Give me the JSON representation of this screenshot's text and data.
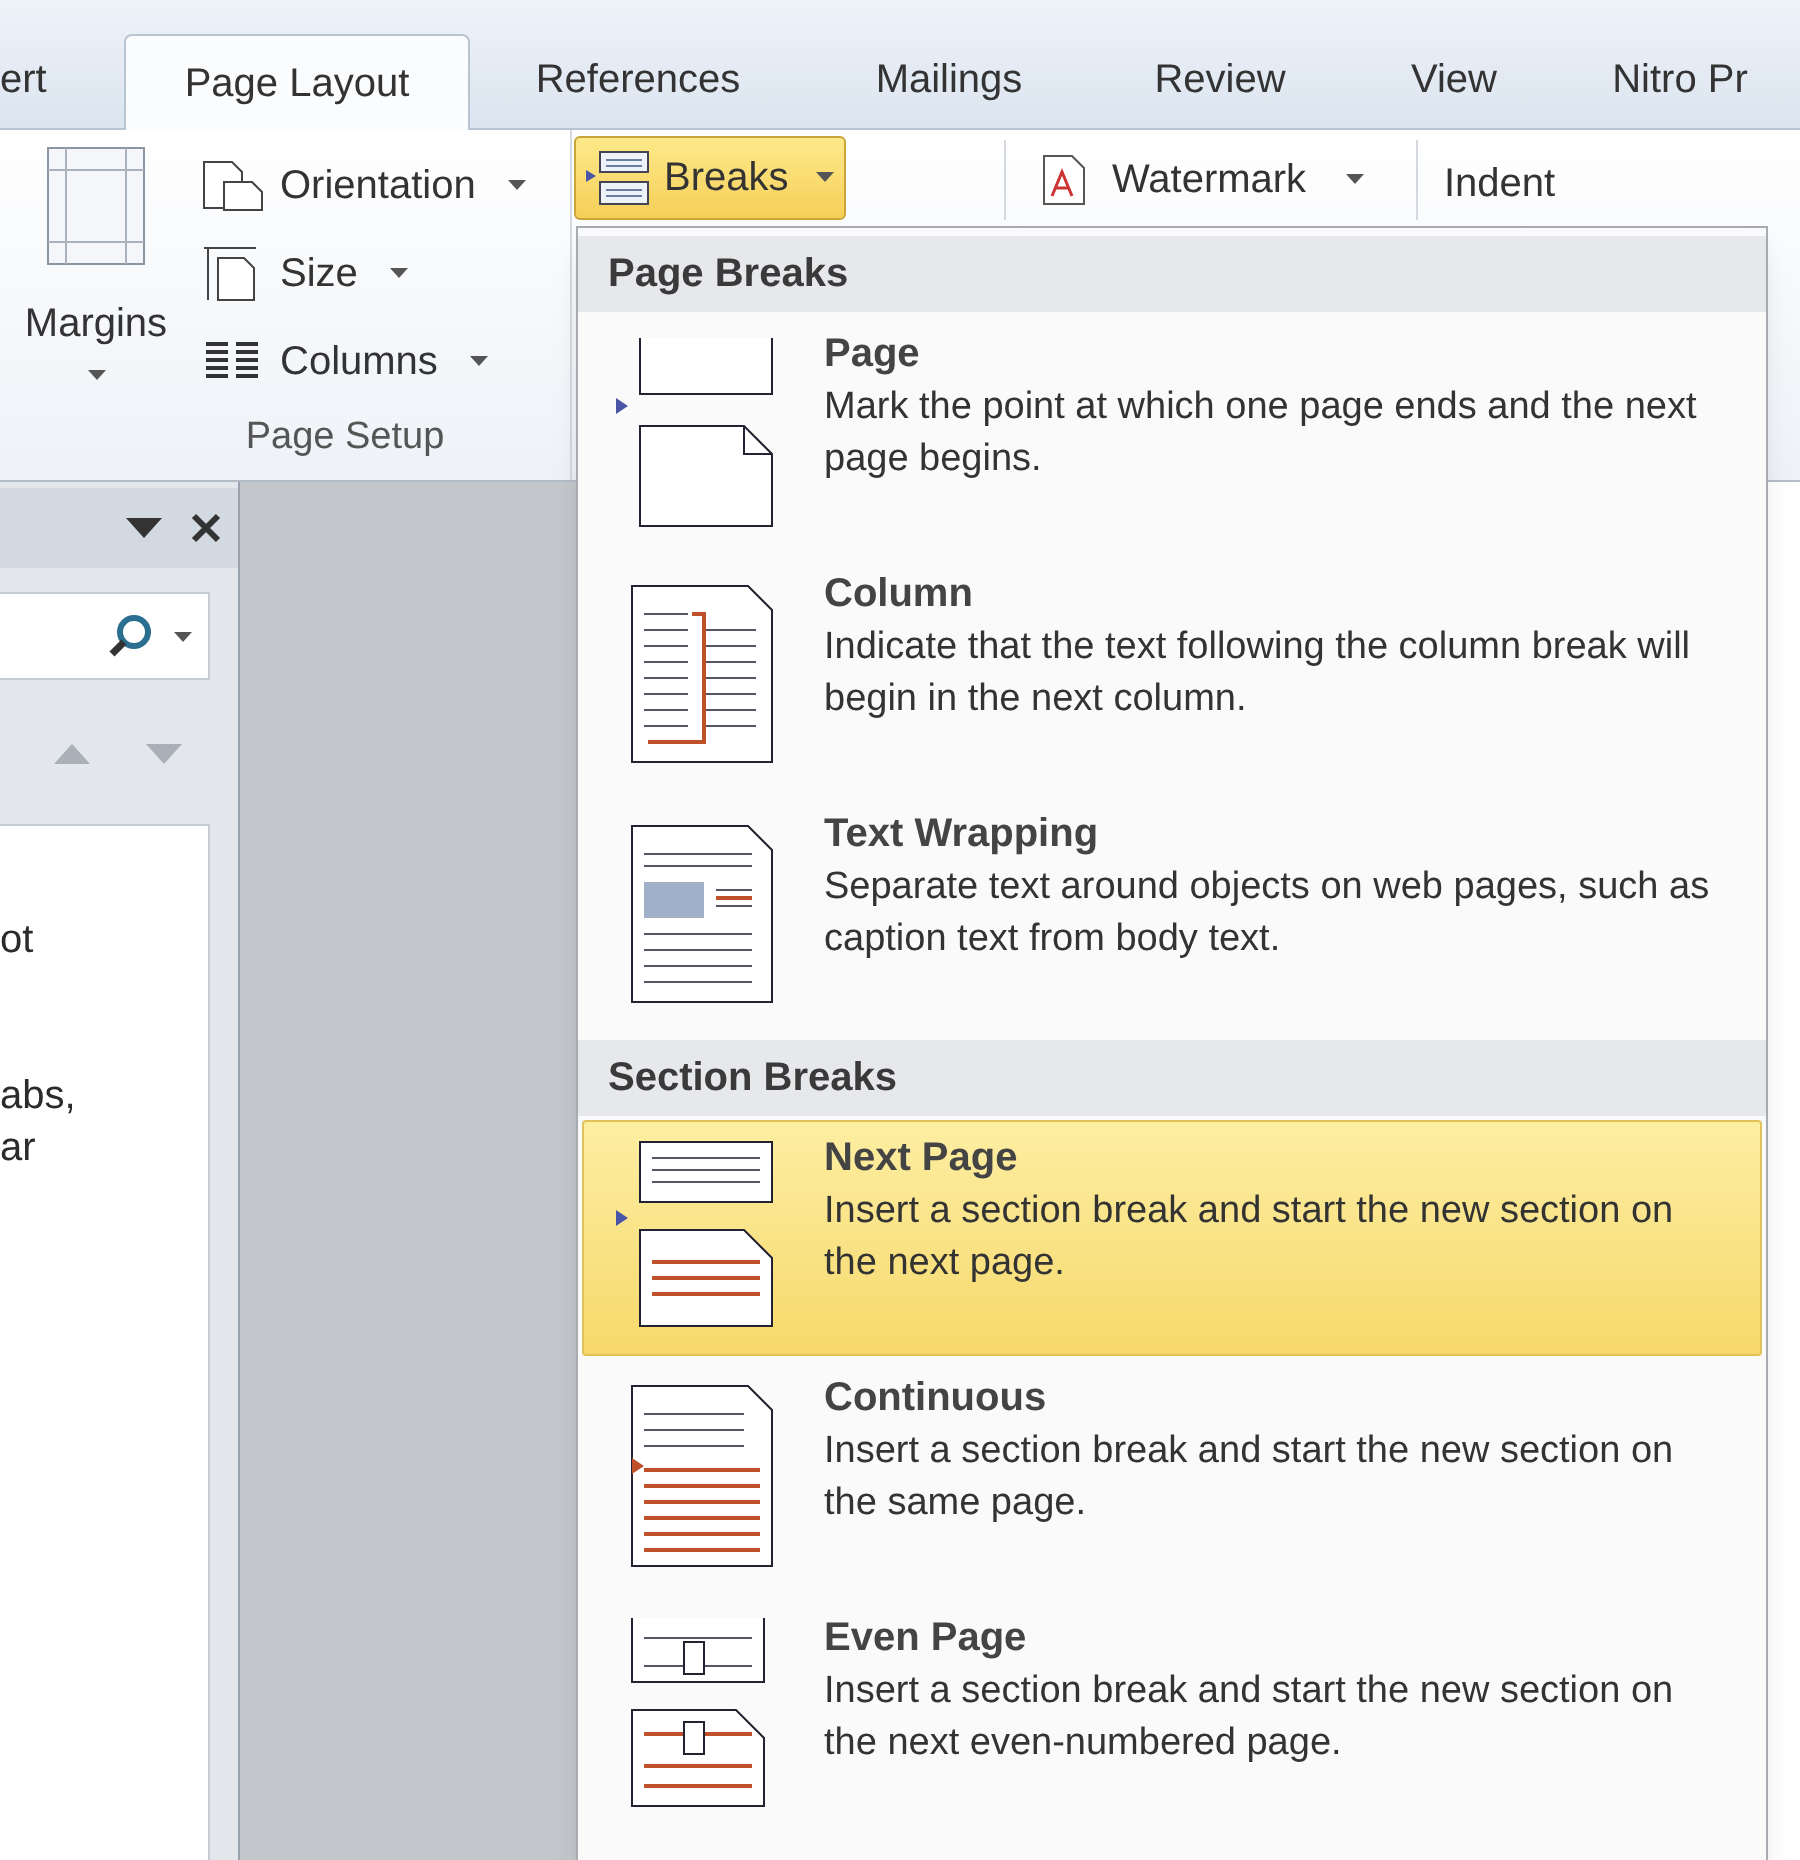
{
  "tabs": [
    {
      "label": "ert",
      "selected": false
    },
    {
      "label": "Page Layout",
      "selected": true
    },
    {
      "label": "References",
      "selected": false
    },
    {
      "label": "Mailings",
      "selected": false
    },
    {
      "label": "Review",
      "selected": false
    },
    {
      "label": "View",
      "selected": false
    },
    {
      "label": "Nitro Pr",
      "selected": false
    }
  ],
  "ribbon": {
    "margins": {
      "label": "Margins"
    },
    "commands": [
      {
        "kind": "orientation",
        "label": "Orientation"
      },
      {
        "kind": "size",
        "label": "Size"
      },
      {
        "kind": "columns",
        "label": "Columns"
      }
    ],
    "breaks": {
      "label": "Breaks",
      "expanded": true
    },
    "group_label": "Page Setup",
    "watermark": {
      "label": "Watermark"
    },
    "indent": {
      "label": "Indent"
    }
  },
  "navigation_pane": {
    "text_fragments": [
      "ot",
      "abs,",
      "ar"
    ]
  },
  "breaks_menu": [
    {
      "title": "Page Breaks",
      "items": [
        {
          "kind": "page",
          "title": "Page",
          "description": "Mark the point at which one page ends and the next page begins.",
          "selected": false
        },
        {
          "kind": "column",
          "title": "Column",
          "description": "Indicate that the text following the column break will begin in the next column.",
          "selected": false
        },
        {
          "kind": "text_wrapping",
          "title": "Text Wrapping",
          "description": "Separate text around objects on web pages, such as caption text from body text.",
          "selected": false
        }
      ]
    },
    {
      "title": "Section Breaks",
      "items": [
        {
          "kind": "next_page",
          "title": "Next Page",
          "description": "Insert a section break and start the new section on the next page.",
          "selected": true
        },
        {
          "kind": "continuous",
          "title": "Continuous",
          "description": "Insert a section break and start the new section on the same page.",
          "selected": false
        },
        {
          "kind": "even_page",
          "title": "Even Page",
          "description": "Insert a section break and start the new section on the next even-numbered page.",
          "selected": false
        }
      ]
    }
  ]
}
